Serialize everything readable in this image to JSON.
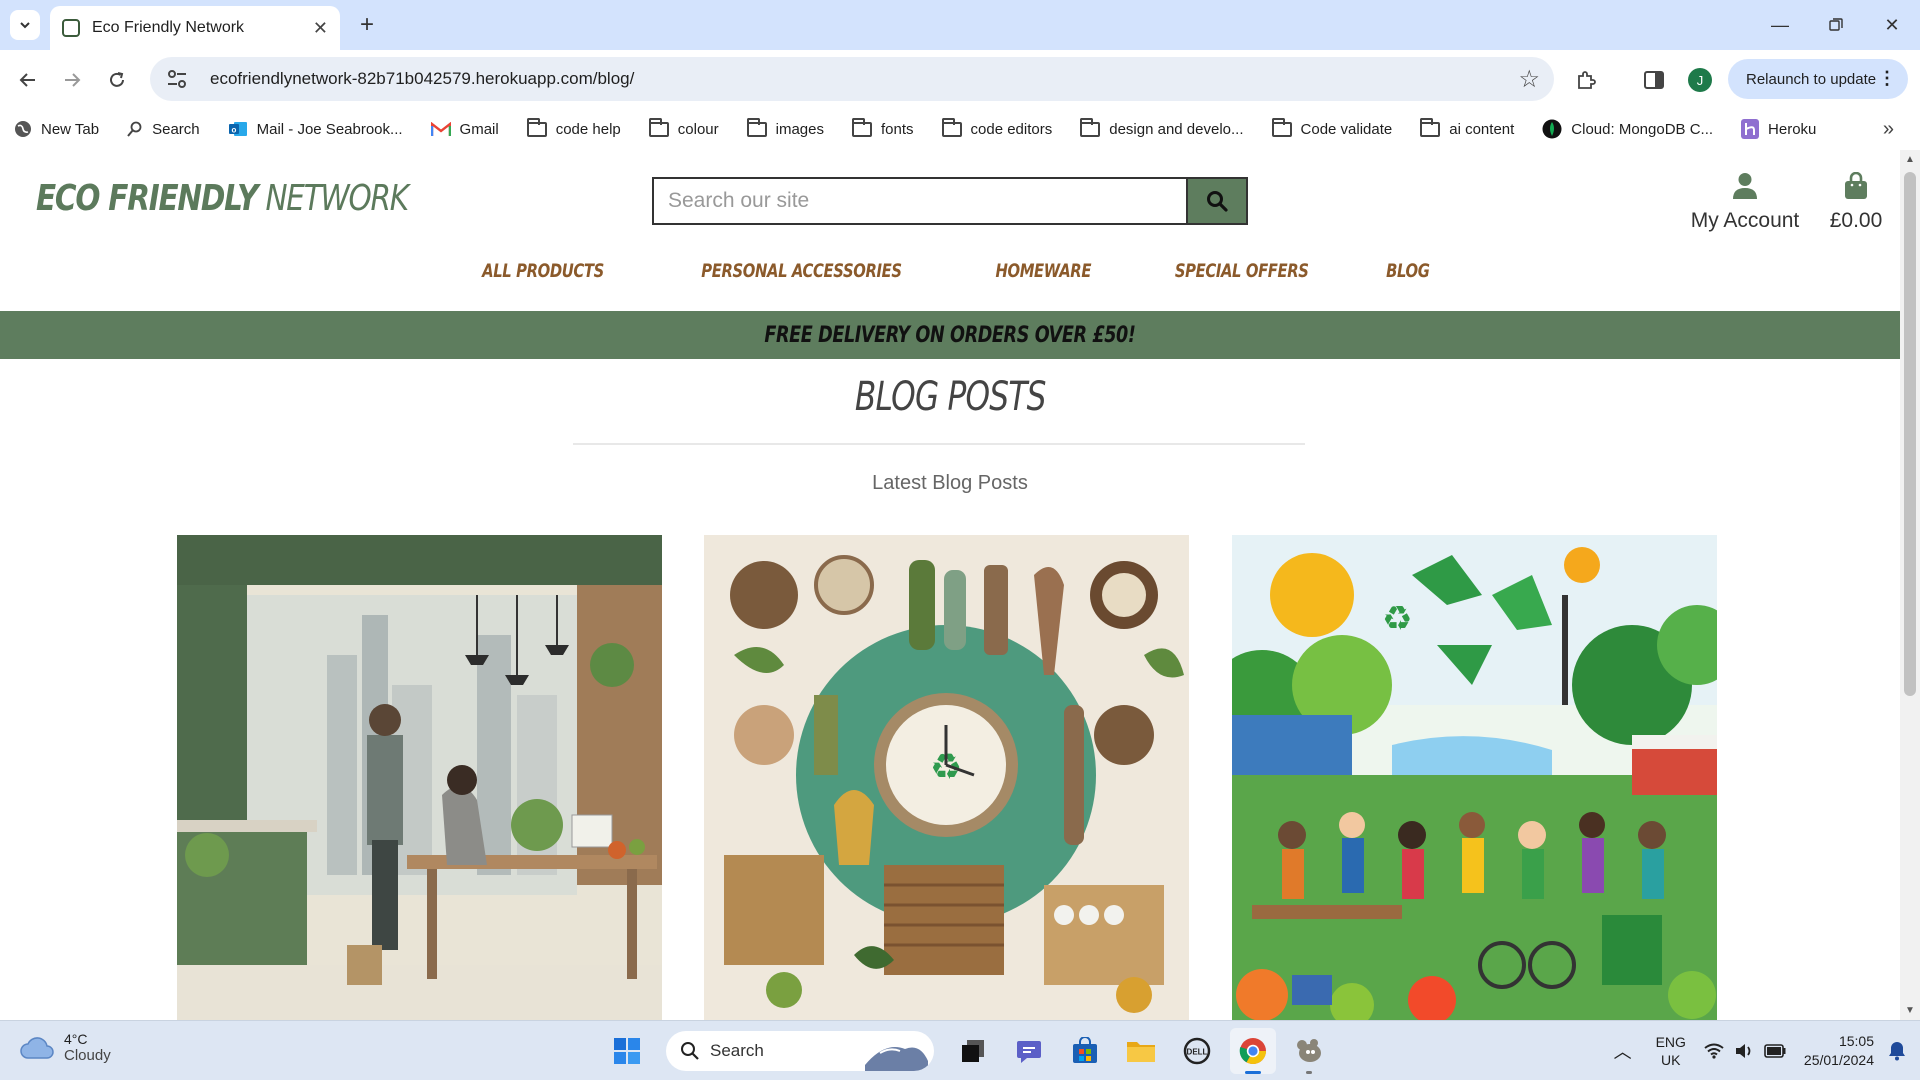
{
  "browser": {
    "tab_title": "Eco Friendly Network",
    "url": "ecofriendlynetwork-82b71b042579.herokuapp.com/blog/",
    "profile_initial": "J",
    "relaunch_label": "Relaunch to update",
    "bookmarks": [
      {
        "label": "New Tab",
        "icon": "globe-icon"
      },
      {
        "label": "Search",
        "icon": "search-icon"
      },
      {
        "label": "Mail - Joe Seabrook...",
        "icon": "outlook-icon"
      },
      {
        "label": "Gmail",
        "icon": "gmail-icon"
      },
      {
        "label": "code help",
        "icon": "folder-icon"
      },
      {
        "label": "colour",
        "icon": "folder-icon"
      },
      {
        "label": "images",
        "icon": "folder-icon"
      },
      {
        "label": "fonts",
        "icon": "folder-icon"
      },
      {
        "label": "code editors",
        "icon": "folder-icon"
      },
      {
        "label": "design and develo...",
        "icon": "folder-icon"
      },
      {
        "label": "Code validate",
        "icon": "folder-icon"
      },
      {
        "label": "ai content",
        "icon": "folder-icon"
      },
      {
        "label": "Cloud: MongoDB C...",
        "icon": "mongodb-icon"
      },
      {
        "label": "Heroku",
        "icon": "heroku-icon"
      }
    ]
  },
  "site": {
    "logo_bold": "ECO FRIENDLY",
    "logo_light": " NETWORK",
    "search_placeholder": "Search our site",
    "account_label": "My Account",
    "bag_total": "£0.00",
    "nav": [
      "ALL PRODUCTS",
      "PERSONAL ACCESSORIES",
      "HOMEWARE",
      "SPECIAL OFFERS",
      "BLOG"
    ],
    "banner": "FREE DELIVERY ON ORDERS OVER £50!",
    "page_title": "BLOG POSTS",
    "subtitle": "Latest Blog Posts",
    "accent_color": "#5e7d5e",
    "nav_color": "#8b5a2b"
  },
  "taskbar": {
    "temperature": "4°C",
    "condition": "Cloudy",
    "search_label": "Search",
    "language": "ENG",
    "region": "UK",
    "time": "15:05",
    "date": "25/01/2024"
  }
}
